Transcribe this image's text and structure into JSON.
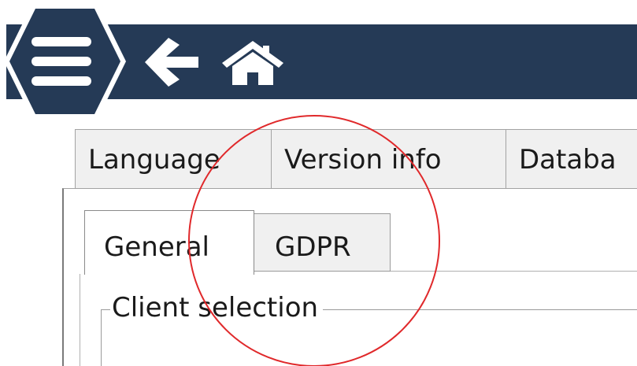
{
  "header": {
    "bar_color": "#253a56",
    "menu_icon": "hamburger-menu-icon",
    "back_icon": "arrow-left-icon",
    "home_icon": "home-icon"
  },
  "outer_tabs": [
    {
      "label": "Language"
    },
    {
      "label": "Version info"
    },
    {
      "label": "Databa"
    }
  ],
  "inner_tabs": [
    {
      "label": "General",
      "selected": true
    },
    {
      "label": "GDPR",
      "selected": false
    }
  ],
  "group": {
    "legend": "Client selection"
  },
  "annotation": {
    "shape": "circle",
    "color": "#e0292b"
  }
}
